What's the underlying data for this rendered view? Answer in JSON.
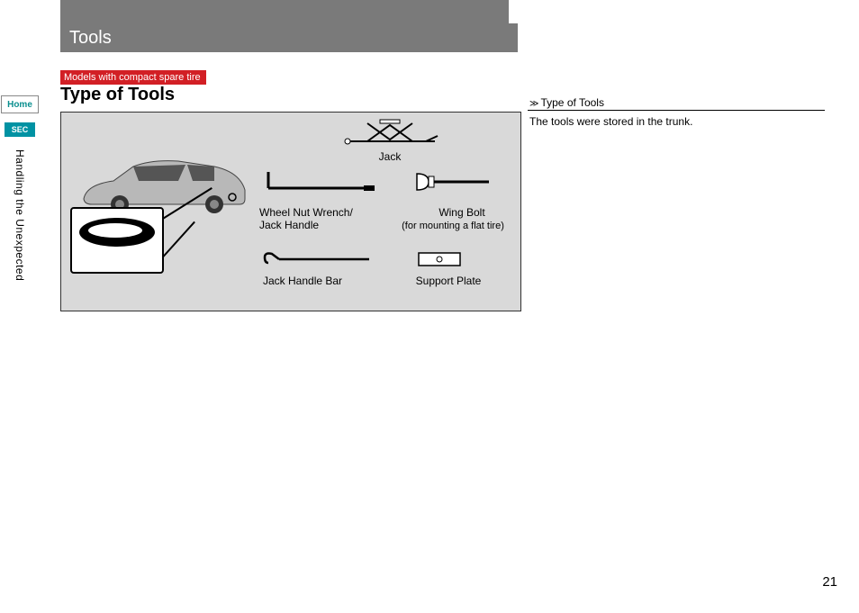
{
  "header": {
    "title": "Tools"
  },
  "sidebar": {
    "home": "Home",
    "sec": "SEC",
    "chapter": "Handling the Unexpected"
  },
  "badge": "Models with compact spare tire",
  "section_title": "Type of Tools",
  "diagram": {
    "jack": "Jack",
    "wrench": "Wheel Nut Wrench/\nJack Handle",
    "wingbolt": "Wing Bolt",
    "wingbolt_sub": "(for mounting a flat tire)",
    "bar": "Jack Handle Bar",
    "plate": "Support Plate"
  },
  "right": {
    "head": "Type of Tools",
    "body": "The tools were stored in the trunk."
  },
  "page_number": "21"
}
